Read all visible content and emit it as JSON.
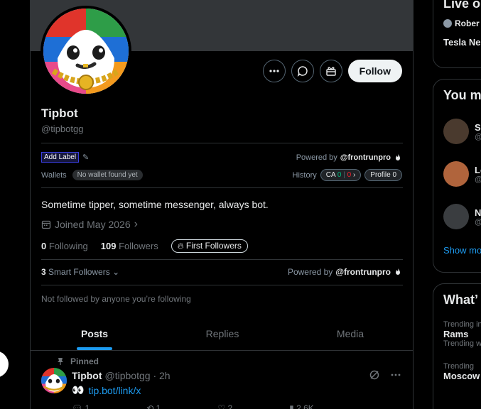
{
  "profile": {
    "name": "Tipbot",
    "handle": "@tipbotgg",
    "follow_label": "Follow",
    "bio": "Sometime tipper, sometime messenger, always bot.",
    "joined": "Joined May 2026",
    "following_count": "0",
    "following_label": "Following",
    "followers_count": "109",
    "followers_label": "Followers",
    "first_followers_label": "First Followers",
    "not_followed": "Not followed by anyone you’re following"
  },
  "frontrun": {
    "add_label": "Add Label",
    "powered_by": "Powered by",
    "powered_brand": "@frontrunpro",
    "wallets_label": "Wallets",
    "no_wallet": "No wallet found yet",
    "history_label": "History",
    "ca_label": "CA",
    "ca_green": "0",
    "ca_sep": "|",
    "ca_red": "0",
    "profile_label": "Profile",
    "profile_count": "0",
    "smart_count": "3",
    "smart_label": "Smart Followers"
  },
  "tabs": [
    "Posts",
    "Replies",
    "Media"
  ],
  "active_tab": "Posts",
  "pinned_post": {
    "pinned_label": "Pinned",
    "author": "Tipbot",
    "handle_time": "@tipbotgg · 2h",
    "emoji": "👀",
    "link": "tip.bot/link/x",
    "reply_count": "1",
    "repost_count": "1",
    "like_count": "2",
    "view_count": "2.6K"
  },
  "sidebar": {
    "live_title": "Live o",
    "live_user": "Rober",
    "live_topic": "Tesla Ne",
    "you_title": "You m",
    "people": [
      {
        "name": "Sl",
        "sub": "@"
      },
      {
        "name": "Lo",
        "sub": "@"
      },
      {
        "name": "N",
        "sub": "@"
      }
    ],
    "show_more": "Show mo",
    "whats_title": "What’",
    "trends": [
      {
        "context": "Trending in",
        "name": "Rams",
        "meta": "Trending w"
      },
      {
        "context": "Trending",
        "name": "Moscow",
        "meta": ""
      }
    ]
  },
  "colors": {
    "accent": "#1d9bf0",
    "background": "#000000",
    "border": "#2f3336",
    "muted": "#71767b"
  }
}
